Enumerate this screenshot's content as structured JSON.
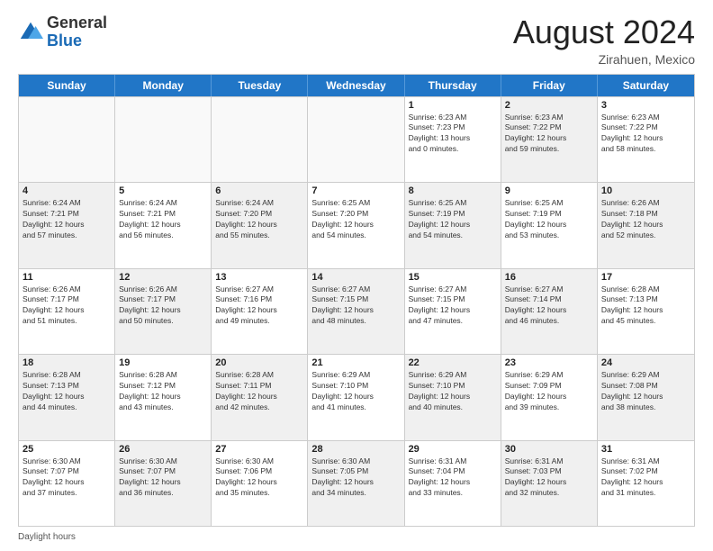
{
  "header": {
    "logo_line1": "General",
    "logo_line2": "Blue",
    "month_year": "August 2024",
    "location": "Zirahuen, Mexico"
  },
  "footer": {
    "label": "Daylight hours"
  },
  "days_of_week": [
    "Sunday",
    "Monday",
    "Tuesday",
    "Wednesday",
    "Thursday",
    "Friday",
    "Saturday"
  ],
  "weeks": [
    [
      {
        "day": "",
        "info": "",
        "shaded": false,
        "empty": true
      },
      {
        "day": "",
        "info": "",
        "shaded": false,
        "empty": true
      },
      {
        "day": "",
        "info": "",
        "shaded": false,
        "empty": true
      },
      {
        "day": "",
        "info": "",
        "shaded": false,
        "empty": true
      },
      {
        "day": "1",
        "info": "Sunrise: 6:23 AM\nSunset: 7:23 PM\nDaylight: 13 hours\nand 0 minutes.",
        "shaded": false,
        "empty": false
      },
      {
        "day": "2",
        "info": "Sunrise: 6:23 AM\nSunset: 7:22 PM\nDaylight: 12 hours\nand 59 minutes.",
        "shaded": true,
        "empty": false
      },
      {
        "day": "3",
        "info": "Sunrise: 6:23 AM\nSunset: 7:22 PM\nDaylight: 12 hours\nand 58 minutes.",
        "shaded": false,
        "empty": false
      }
    ],
    [
      {
        "day": "4",
        "info": "Sunrise: 6:24 AM\nSunset: 7:21 PM\nDaylight: 12 hours\nand 57 minutes.",
        "shaded": true,
        "empty": false
      },
      {
        "day": "5",
        "info": "Sunrise: 6:24 AM\nSunset: 7:21 PM\nDaylight: 12 hours\nand 56 minutes.",
        "shaded": false,
        "empty": false
      },
      {
        "day": "6",
        "info": "Sunrise: 6:24 AM\nSunset: 7:20 PM\nDaylight: 12 hours\nand 55 minutes.",
        "shaded": true,
        "empty": false
      },
      {
        "day": "7",
        "info": "Sunrise: 6:25 AM\nSunset: 7:20 PM\nDaylight: 12 hours\nand 54 minutes.",
        "shaded": false,
        "empty": false
      },
      {
        "day": "8",
        "info": "Sunrise: 6:25 AM\nSunset: 7:19 PM\nDaylight: 12 hours\nand 54 minutes.",
        "shaded": true,
        "empty": false
      },
      {
        "day": "9",
        "info": "Sunrise: 6:25 AM\nSunset: 7:19 PM\nDaylight: 12 hours\nand 53 minutes.",
        "shaded": false,
        "empty": false
      },
      {
        "day": "10",
        "info": "Sunrise: 6:26 AM\nSunset: 7:18 PM\nDaylight: 12 hours\nand 52 minutes.",
        "shaded": true,
        "empty": false
      }
    ],
    [
      {
        "day": "11",
        "info": "Sunrise: 6:26 AM\nSunset: 7:17 PM\nDaylight: 12 hours\nand 51 minutes.",
        "shaded": false,
        "empty": false
      },
      {
        "day": "12",
        "info": "Sunrise: 6:26 AM\nSunset: 7:17 PM\nDaylight: 12 hours\nand 50 minutes.",
        "shaded": true,
        "empty": false
      },
      {
        "day": "13",
        "info": "Sunrise: 6:27 AM\nSunset: 7:16 PM\nDaylight: 12 hours\nand 49 minutes.",
        "shaded": false,
        "empty": false
      },
      {
        "day": "14",
        "info": "Sunrise: 6:27 AM\nSunset: 7:15 PM\nDaylight: 12 hours\nand 48 minutes.",
        "shaded": true,
        "empty": false
      },
      {
        "day": "15",
        "info": "Sunrise: 6:27 AM\nSunset: 7:15 PM\nDaylight: 12 hours\nand 47 minutes.",
        "shaded": false,
        "empty": false
      },
      {
        "day": "16",
        "info": "Sunrise: 6:27 AM\nSunset: 7:14 PM\nDaylight: 12 hours\nand 46 minutes.",
        "shaded": true,
        "empty": false
      },
      {
        "day": "17",
        "info": "Sunrise: 6:28 AM\nSunset: 7:13 PM\nDaylight: 12 hours\nand 45 minutes.",
        "shaded": false,
        "empty": false
      }
    ],
    [
      {
        "day": "18",
        "info": "Sunrise: 6:28 AM\nSunset: 7:13 PM\nDaylight: 12 hours\nand 44 minutes.",
        "shaded": true,
        "empty": false
      },
      {
        "day": "19",
        "info": "Sunrise: 6:28 AM\nSunset: 7:12 PM\nDaylight: 12 hours\nand 43 minutes.",
        "shaded": false,
        "empty": false
      },
      {
        "day": "20",
        "info": "Sunrise: 6:28 AM\nSunset: 7:11 PM\nDaylight: 12 hours\nand 42 minutes.",
        "shaded": true,
        "empty": false
      },
      {
        "day": "21",
        "info": "Sunrise: 6:29 AM\nSunset: 7:10 PM\nDaylight: 12 hours\nand 41 minutes.",
        "shaded": false,
        "empty": false
      },
      {
        "day": "22",
        "info": "Sunrise: 6:29 AM\nSunset: 7:10 PM\nDaylight: 12 hours\nand 40 minutes.",
        "shaded": true,
        "empty": false
      },
      {
        "day": "23",
        "info": "Sunrise: 6:29 AM\nSunset: 7:09 PM\nDaylight: 12 hours\nand 39 minutes.",
        "shaded": false,
        "empty": false
      },
      {
        "day": "24",
        "info": "Sunrise: 6:29 AM\nSunset: 7:08 PM\nDaylight: 12 hours\nand 38 minutes.",
        "shaded": true,
        "empty": false
      }
    ],
    [
      {
        "day": "25",
        "info": "Sunrise: 6:30 AM\nSunset: 7:07 PM\nDaylight: 12 hours\nand 37 minutes.",
        "shaded": false,
        "empty": false
      },
      {
        "day": "26",
        "info": "Sunrise: 6:30 AM\nSunset: 7:07 PM\nDaylight: 12 hours\nand 36 minutes.",
        "shaded": true,
        "empty": false
      },
      {
        "day": "27",
        "info": "Sunrise: 6:30 AM\nSunset: 7:06 PM\nDaylight: 12 hours\nand 35 minutes.",
        "shaded": false,
        "empty": false
      },
      {
        "day": "28",
        "info": "Sunrise: 6:30 AM\nSunset: 7:05 PM\nDaylight: 12 hours\nand 34 minutes.",
        "shaded": true,
        "empty": false
      },
      {
        "day": "29",
        "info": "Sunrise: 6:31 AM\nSunset: 7:04 PM\nDaylight: 12 hours\nand 33 minutes.",
        "shaded": false,
        "empty": false
      },
      {
        "day": "30",
        "info": "Sunrise: 6:31 AM\nSunset: 7:03 PM\nDaylight: 12 hours\nand 32 minutes.",
        "shaded": true,
        "empty": false
      },
      {
        "day": "31",
        "info": "Sunrise: 6:31 AM\nSunset: 7:02 PM\nDaylight: 12 hours\nand 31 minutes.",
        "shaded": false,
        "empty": false
      }
    ]
  ]
}
